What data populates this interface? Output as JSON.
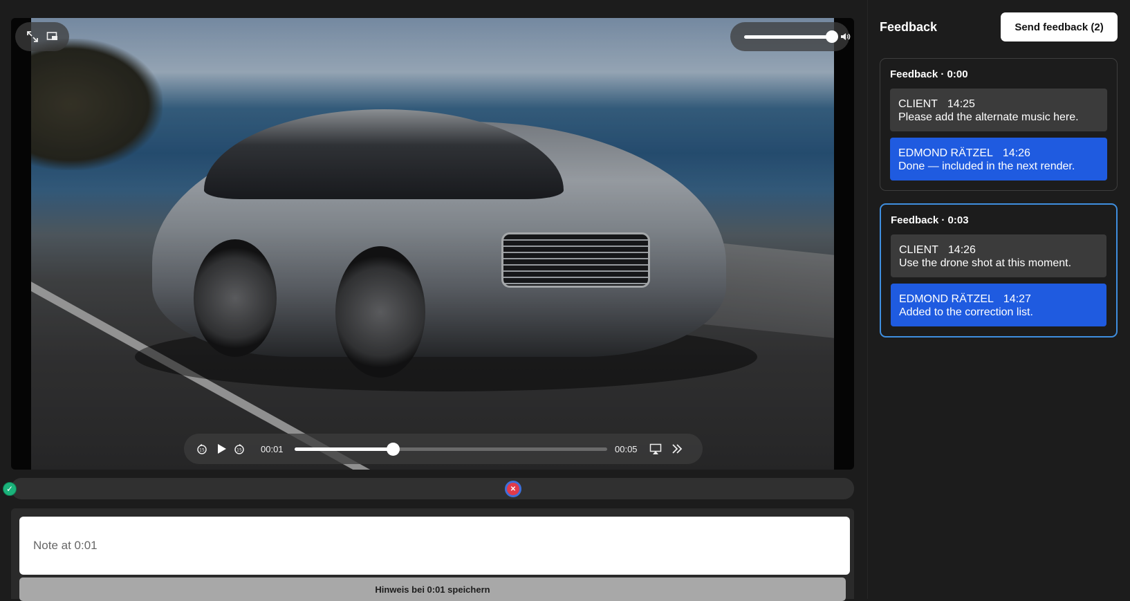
{
  "player": {
    "current_time": "00:01",
    "duration": "00:05",
    "progress_fraction": 0.315,
    "volume_fraction": 1.0
  },
  "timeline": {
    "start_marker_icon": "check-icon",
    "current_marker_icon": "close-icon"
  },
  "note": {
    "placeholder": "Note at 0:01",
    "save_label": "Hinweis bei 0:01 speichern"
  },
  "sidebar": {
    "title": "Feedback",
    "send_label": "Send feedback (2)",
    "threads": [
      {
        "title": "Feedback · 0:00",
        "messages": [
          {
            "author": "CLIENT",
            "time": "14:25",
            "text": "Please add the alternate music here.",
            "role": "client"
          },
          {
            "author": "EDMOND RÄTZEL",
            "time": "14:26",
            "text": "Done — included in the next render.",
            "role": "editor"
          }
        ]
      },
      {
        "title": "Feedback · 0:03",
        "messages": [
          {
            "author": "CLIENT",
            "time": "14:26",
            "text": "Use the drone shot at this moment.",
            "role": "client"
          },
          {
            "author": "EDMOND RÄTZEL",
            "time": "14:27",
            "text": "Added to the correction list.",
            "role": "editor"
          }
        ]
      }
    ]
  },
  "colors": {
    "accent_blue": "#1f5be0",
    "active_border": "#3f8fe0",
    "marker_green": "#1bb37b",
    "marker_red": "#e13a4a"
  }
}
